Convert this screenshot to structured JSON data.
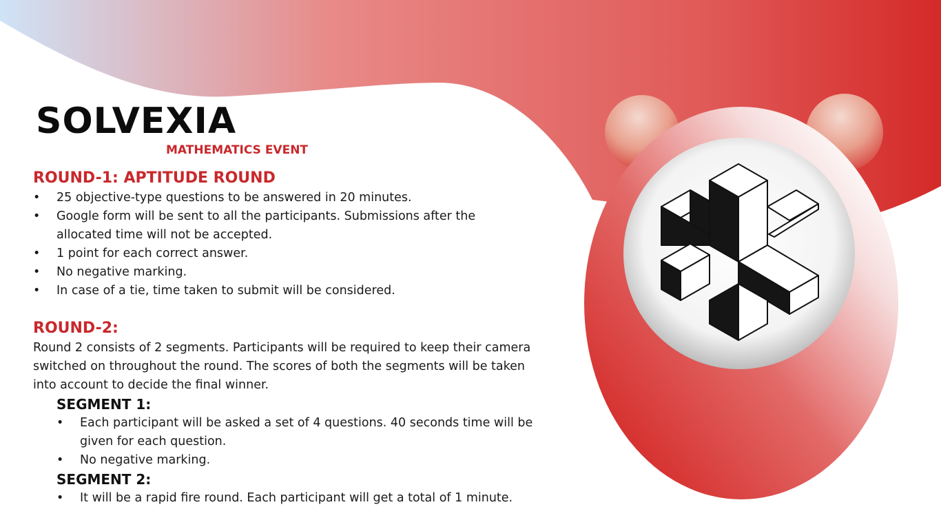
{
  "event": {
    "title": "SOLVEXIA",
    "subtitle": "MATHEMATICS EVENT"
  },
  "rounds": [
    {
      "heading": "ROUND-1: APTITUDE ROUND",
      "bullets": [
        "25 objective-type questions to be answered in 20 minutes.",
        "Google form will be sent to all the participants. Submissions after the allocated time will not be accepted.",
        "1 point for each correct answer.",
        "No negative marking.",
        "In case of a tie, time taken to submit will be considered."
      ]
    },
    {
      "heading": "ROUND-2:",
      "intro": "Round 2 consists of 2 segments. Participants will be required to keep their camera switched on throughout the round. The scores of both the segments will be taken into account to decide the final winner.",
      "segments": [
        {
          "heading": "SEGMENT 1:",
          "bullets": [
            "Each participant will be asked a set of 4 questions. 40 seconds time will be given for each question.",
            "No negative marking."
          ]
        },
        {
          "heading": "SEGMENT 2:",
          "bullets": [
            "It will be a rapid fire round. Each participant will get a total of 1 minute."
          ]
        }
      ]
    }
  ],
  "bullet_glyph": "•",
  "colors": {
    "accent": "#c8282c",
    "wave_start": "#cfe3f7",
    "wave_end": "#d42a28"
  },
  "icons": {
    "mascot": "red-bear-mascot-icon",
    "logo": "isometric-cube-logo-icon"
  }
}
